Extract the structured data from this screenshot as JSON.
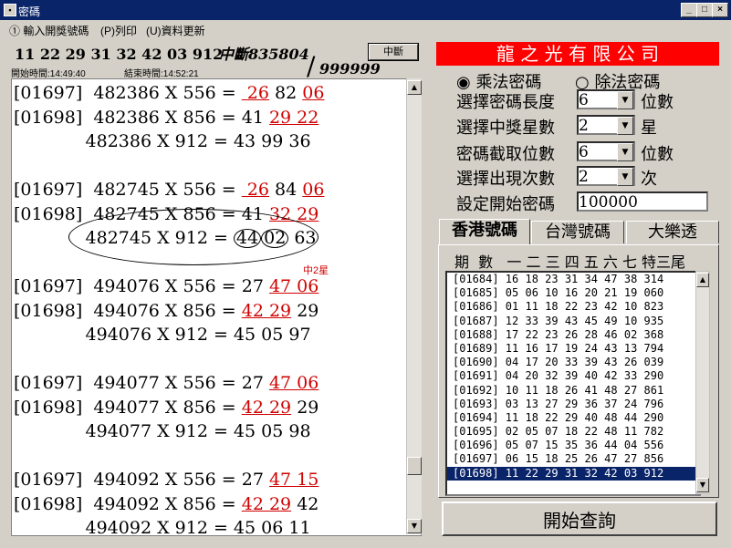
{
  "window": {
    "title": "密碼"
  },
  "menu": [
    {
      "label": "① 輸入開獎號碼"
    },
    {
      "label": "(P)列印"
    },
    {
      "label": "(U)資料更新"
    }
  ],
  "header": {
    "numbers": "11 22 29 31 32 42 03 912",
    "stop_text": "中斷835804",
    "stop_max": "999999",
    "slash": "/",
    "start_time": "開始時間:14:49:40",
    "end_time": "結束時間:14:52:21",
    "stop_button": "中斷"
  },
  "calc_lines": [
    {
      "head": "[01697]  482386 X 556 = ",
      "seg": [
        {
          "t": " 26",
          "r": 1
        },
        {
          "t": " 82 ",
          "r": 0
        },
        {
          "t": "06",
          "r": 1
        }
      ]
    },
    {
      "head": "[01698]  482386 X 856 = ",
      "seg": [
        {
          "t": "41 ",
          "r": 0
        },
        {
          "t": "29 22",
          "r": 1
        }
      ]
    },
    {
      "head": "             482386 X 912 = ",
      "seg": [
        {
          "t": "43 99 36",
          "r": 0
        }
      ]
    },
    {
      "head": "",
      "seg": []
    },
    {
      "head": "[01697]  482745 X 556 = ",
      "seg": [
        {
          "t": " 26",
          "r": 1
        },
        {
          "t": " 84 ",
          "r": 0
        },
        {
          "t": "06",
          "r": 1
        }
      ]
    },
    {
      "head": "[01698]  482745 X 856 = ",
      "seg": [
        {
          "t": "41 ",
          "r": 0
        },
        {
          "t": "32 29",
          "r": 1
        }
      ]
    },
    {
      "head": "             482745 X 912 = ",
      "seg": [
        {
          "t": "44",
          "c": 1
        },
        {
          "t": "02",
          "c": 1
        },
        {
          "t": " 63",
          "r": 0
        }
      ]
    },
    {
      "head": "",
      "seg": []
    },
    {
      "head": "[01697]  494076 X 556 = ",
      "seg": [
        {
          "t": "27 ",
          "r": 0
        },
        {
          "t": "47 06",
          "r": 1
        }
      ]
    },
    {
      "head": "[01698]  494076 X 856 = ",
      "seg": [
        {
          "t": "42 29",
          "r": 1
        },
        {
          "t": " 29",
          "r": 0
        }
      ]
    },
    {
      "head": "             494076 X 912 = ",
      "seg": [
        {
          "t": "45 05 97",
          "r": 0
        }
      ]
    },
    {
      "head": "",
      "seg": []
    },
    {
      "head": "[01697]  494077 X 556 = ",
      "seg": [
        {
          "t": "27 ",
          "r": 0
        },
        {
          "t": "47 06",
          "r": 1
        }
      ]
    },
    {
      "head": "[01698]  494077 X 856 = ",
      "seg": [
        {
          "t": "42 29",
          "r": 1
        },
        {
          "t": " 29",
          "r": 0
        }
      ]
    },
    {
      "head": "             494077 X 912 = ",
      "seg": [
        {
          "t": "45 05 98",
          "r": 0
        }
      ]
    },
    {
      "head": "",
      "seg": []
    },
    {
      "head": "[01697]  494092 X 556 = ",
      "seg": [
        {
          "t": "27 ",
          "r": 0
        },
        {
          "t": "47 15",
          "r": 1
        }
      ]
    },
    {
      "head": "[01698]  494092 X 856 = ",
      "seg": [
        {
          "t": "42 29",
          "r": 1
        },
        {
          "t": " 42",
          "r": 0
        }
      ]
    },
    {
      "head": "             494092 X 912 = ",
      "seg": [
        {
          "t": "45 06 11",
          "r": 0
        }
      ]
    }
  ],
  "hit_label": "中2星",
  "right": {
    "company": "龍 之 光 有 限 公 司",
    "radio_multiply": "乘法密碼",
    "radio_divide": "除法密碼",
    "row1_label": "選擇密碼長度",
    "row1_value": "6",
    "row1_unit": "位數",
    "row2_label": "選擇中獎星數",
    "row2_value": "2",
    "row2_unit": "星",
    "row3_label": "密碼截取位數",
    "row3_value": "6",
    "row3_unit": "位數",
    "row4_label": "選擇出現次數",
    "row4_value": "2",
    "row4_unit": "次",
    "row5_label": "設定開始密碼",
    "row5_value": "100000",
    "tabs": [
      "香港號碼",
      "台灣號碼",
      "大樂透"
    ],
    "col_header": "期  數   一 二 三 四 五 六 七 特三尾",
    "start_button": "開始查詢"
  },
  "code_rows": [
    "[01684] 16 18 23 31 34 47 38 314",
    "[01685] 05 06 10 16 20 21 19 060",
    "[01686] 01 11 18 22 23 42 10 823",
    "[01687] 12 33 39 43 45 49 10 935",
    "[01688] 17 22 23 26 28 46 02 368",
    "[01689] 11 16 17 19 24 43 13 794",
    "[01690] 04 17 20 33 39 43 26 039",
    "[01691] 04 20 32 39 40 42 33 290",
    "[01692] 10 11 18 26 41 48 27 861",
    "[01693] 03 13 27 29 36 37 24 796",
    "[01694] 11 18 22 29 40 48 44 290",
    "[01695] 02 05 07 18 22 48 11 782",
    "[01696] 05 07 15 35 36 44 04 556",
    "[01697] 06 15 18 25 26 47 27 856",
    "[01698] 11 22 29 31 32 42 03 912"
  ],
  "colors": {
    "company_bg": "#ff0000",
    "highlight_red": "#d00000",
    "selection_bg": "#0a246a"
  }
}
